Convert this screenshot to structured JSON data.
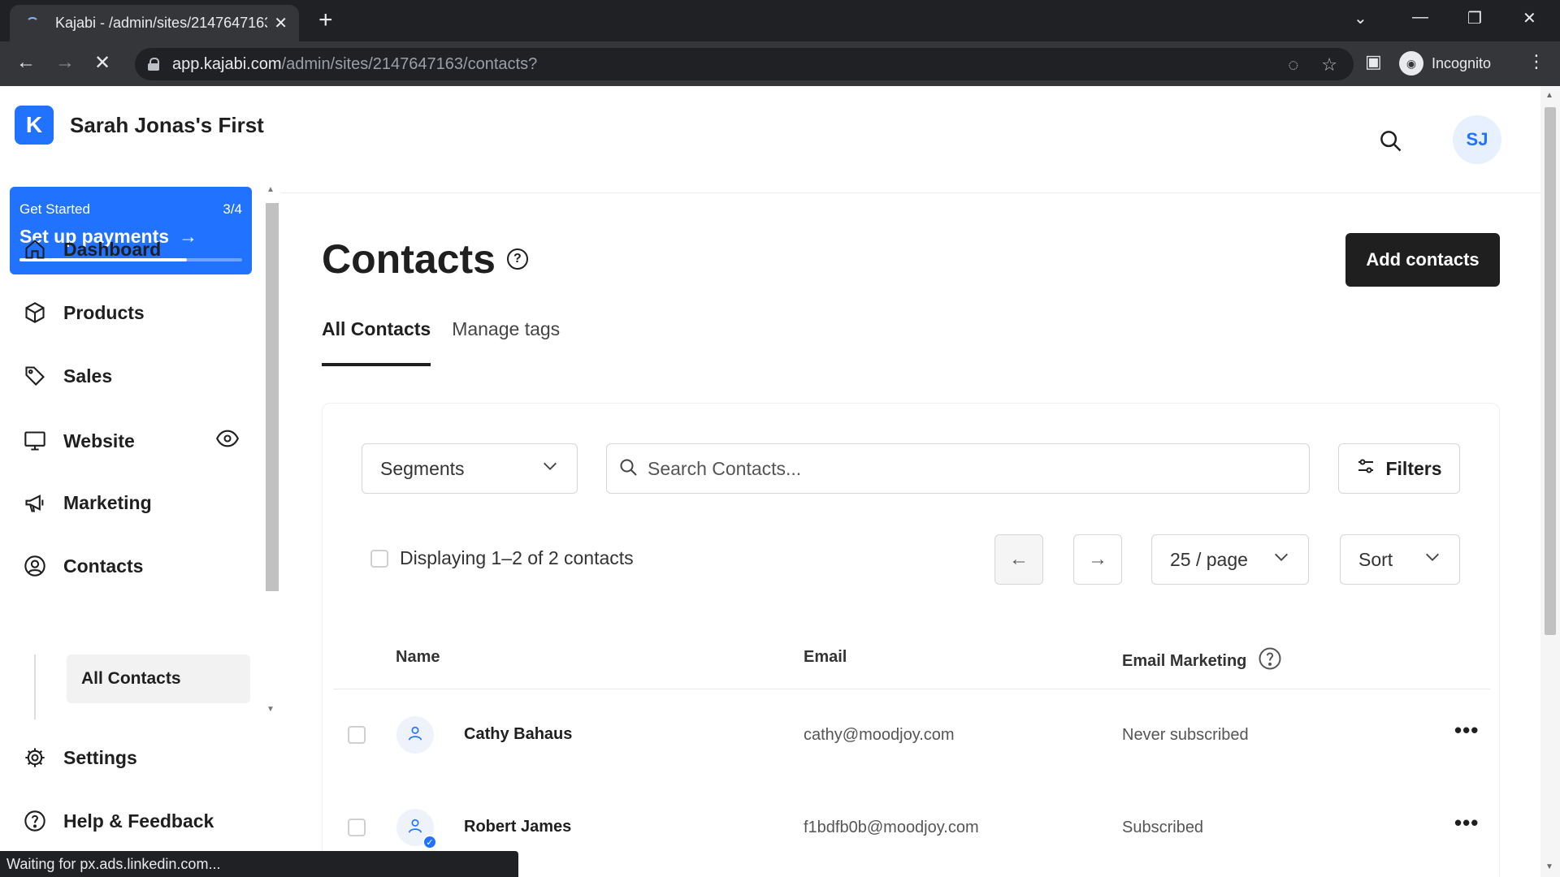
{
  "browser": {
    "tab_title": "Kajabi - /admin/sites/2147647163",
    "url_host": "app.kajabi.com",
    "url_path": "/admin/sites/2147647163/contacts?",
    "profile_label": "Incognito",
    "status_text": "Waiting for px.ads.linkedin.com..."
  },
  "sidebar": {
    "brand_name": "Sarah Jonas's First",
    "get_started": {
      "label": "Get Started",
      "progress_text": "3/4",
      "progress_fraction": 0.75,
      "title": "Set up payments"
    },
    "items": [
      {
        "label": "Dashboard",
        "icon": "home-icon"
      },
      {
        "label": "Products",
        "icon": "box-icon"
      },
      {
        "label": "Sales",
        "icon": "tag-icon"
      },
      {
        "label": "Website",
        "icon": "monitor-icon"
      },
      {
        "label": "Marketing",
        "icon": "megaphone-icon"
      },
      {
        "label": "Contacts",
        "icon": "user-circle-icon"
      },
      {
        "label": "Settings",
        "icon": "gear-icon"
      },
      {
        "label": "Help & Feedback",
        "icon": "help-circle-icon"
      }
    ],
    "sub_item": "All Contacts"
  },
  "header": {
    "avatar_initials": "SJ"
  },
  "page": {
    "title": "Contacts",
    "add_button": "Add contacts",
    "tabs": [
      "All Contacts",
      "Manage tags"
    ],
    "active_tab": "All Contacts"
  },
  "toolbar": {
    "segments_label": "Segments",
    "search_placeholder": "Search Contacts...",
    "filters_label": "Filters",
    "displaying_text": "Displaying 1–2 of 2 contacts",
    "per_page": "25 / page",
    "sort_label": "Sort"
  },
  "table": {
    "columns": [
      "Name",
      "Email",
      "Email Marketing"
    ],
    "rows": [
      {
        "name": "Cathy Bahaus",
        "email": "cathy@moodjoy.com",
        "marketing": "Never subscribed",
        "verified": false
      },
      {
        "name": "Robert James",
        "email": "f1bdfb0b@moodjoy.com",
        "marketing": "Subscribed",
        "verified": true
      }
    ]
  },
  "colors": {
    "accent": "#2172ff",
    "primary_button": "#1f1f1f"
  }
}
